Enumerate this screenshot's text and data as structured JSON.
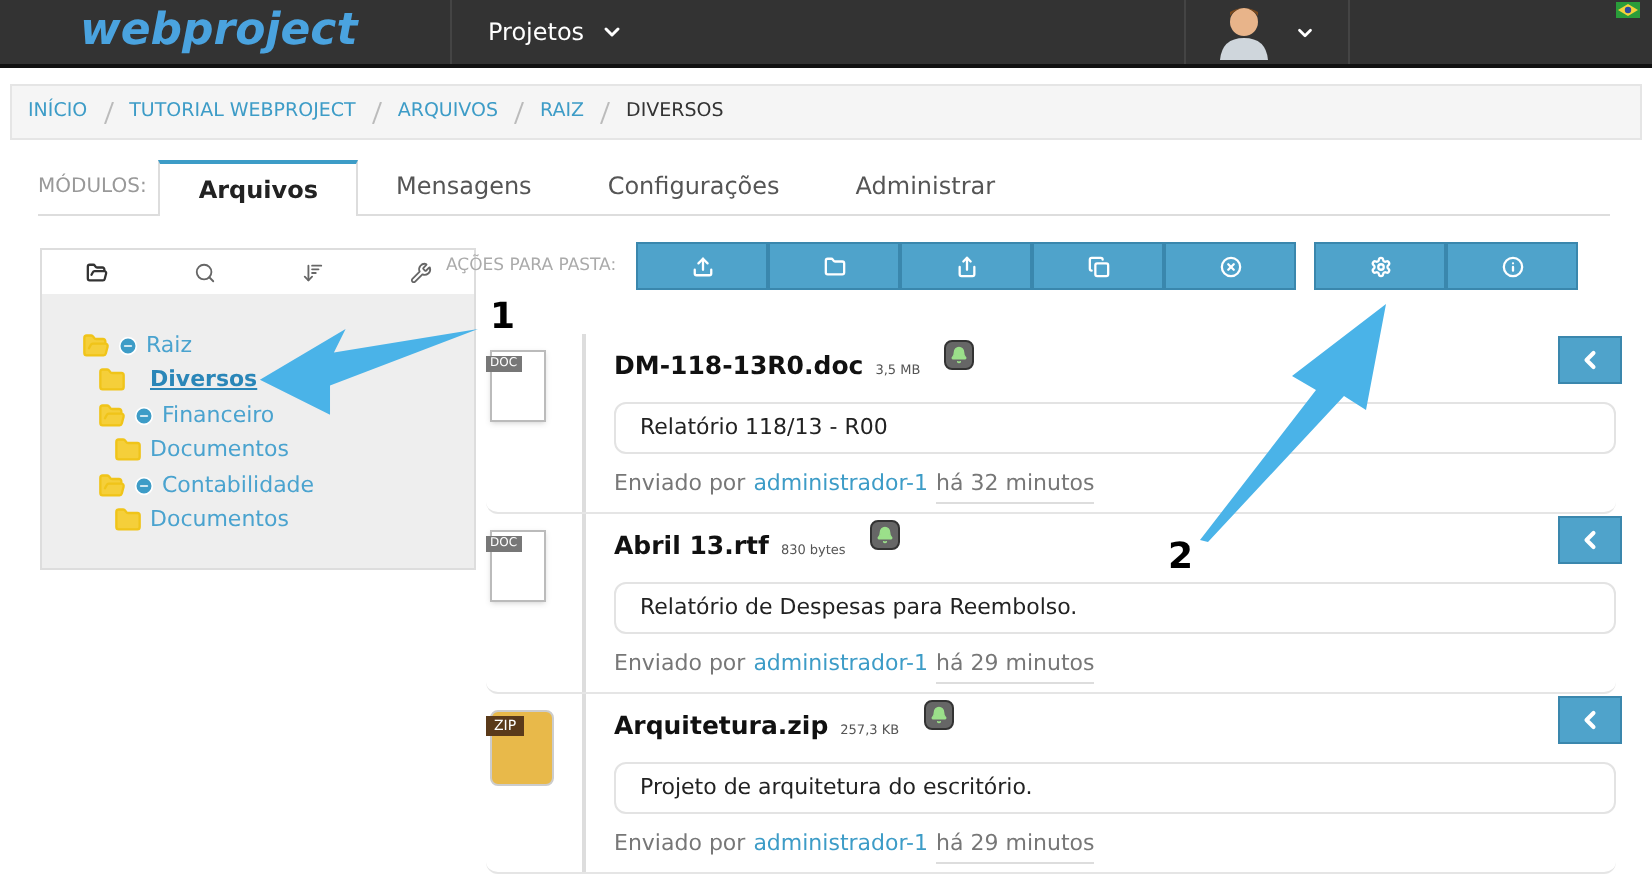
{
  "topbar": {
    "logo": "webproject",
    "menu": "Projetos"
  },
  "breadcrumb": [
    {
      "label": "INÍCIO",
      "current": false
    },
    {
      "label": "TUTORIAL WEBPROJECT",
      "current": false
    },
    {
      "label": "ARQUIVOS",
      "current": false
    },
    {
      "label": "RAIZ",
      "current": false
    },
    {
      "label": "DIVERSOS",
      "current": true
    }
  ],
  "modules": {
    "label": "MÓDULOS:",
    "tabs": [
      {
        "label": "Arquivos",
        "selected": true
      },
      {
        "label": "Mensagens",
        "selected": false
      },
      {
        "label": "Configurações",
        "selected": false
      },
      {
        "label": "Administrar",
        "selected": false
      }
    ]
  },
  "sidebar": {
    "tabs": [
      {
        "kind": "folder",
        "selected": true
      },
      {
        "kind": "search",
        "selected": false
      },
      {
        "kind": "sort",
        "selected": false
      },
      {
        "kind": "wrench",
        "selected": false
      }
    ],
    "tree": [
      {
        "label": "Raiz",
        "expanded": true,
        "selected": false,
        "children": [
          {
            "label": "Diversos",
            "selected": true
          },
          {
            "label": "Financeiro",
            "expanded": true,
            "selected": false,
            "children": [
              {
                "label": "Documentos",
                "selected": false
              }
            ]
          },
          {
            "label": "Contabilidade",
            "expanded": true,
            "selected": false,
            "children": [
              {
                "label": "Documentos",
                "selected": false
              }
            ]
          }
        ]
      }
    ]
  },
  "actions": {
    "label": "AÇÕES PARA PASTA:",
    "groups": [
      [
        {
          "kind": "upload"
        },
        {
          "kind": "folder"
        },
        {
          "kind": "share"
        },
        {
          "kind": "copy"
        },
        {
          "kind": "delete"
        }
      ],
      [
        {
          "kind": "settings"
        },
        {
          "kind": "info"
        }
      ]
    ]
  },
  "files": [
    {
      "type": "DOC",
      "name": "DM-118-13R0.doc",
      "size": "3,5 MB",
      "description": "Relatório 118/13 - R00",
      "sent_by": "Enviado por",
      "user": "administrador-1",
      "time": "há 32 minutos"
    },
    {
      "type": "DOC",
      "name": "Abril 13.rtf",
      "size": "830 bytes",
      "description": "Relatório de Despesas para Reembolso.",
      "sent_by": "Enviado por",
      "user": "administrador-1",
      "time": "há 29 minutos"
    },
    {
      "type": "ZIP",
      "name": "Arquitetura.zip",
      "size": "257,3 KB",
      "description": "Projeto de arquitetura do escritório.",
      "sent_by": "Enviado por",
      "user": "administrador-1",
      "time": "há 29 minutos"
    }
  ],
  "callouts": [
    {
      "number": "1"
    },
    {
      "number": "2"
    }
  ]
}
